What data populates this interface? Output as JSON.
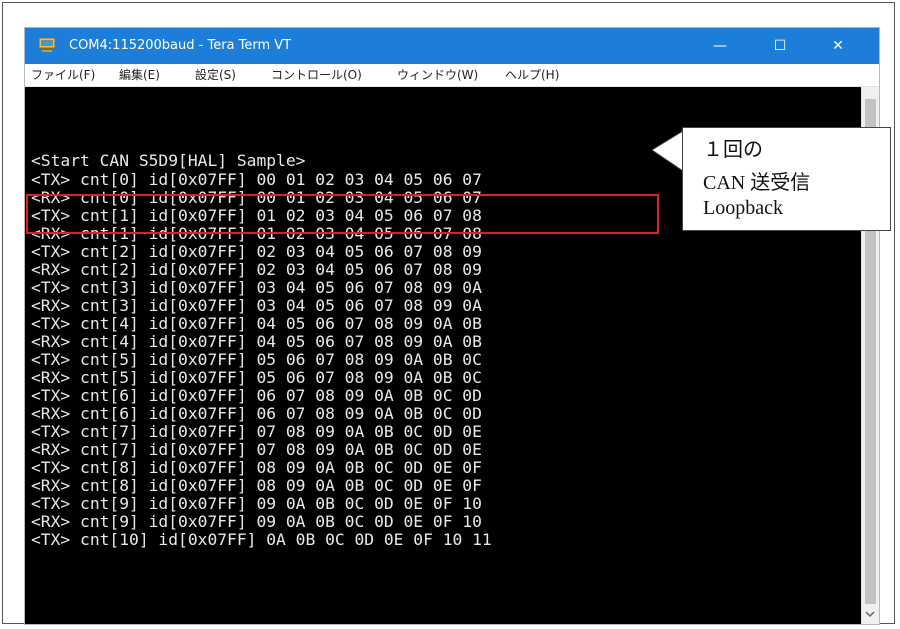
{
  "window": {
    "title": "COM4:115200baud - Tera Term VT",
    "controls": {
      "minimize": "—",
      "maximize": "☐",
      "close": "✕"
    }
  },
  "menu": [
    {
      "label": "ファイル(F)"
    },
    {
      "label": "編集(E)"
    },
    {
      "label": "設定(S)"
    },
    {
      "label": "コントロール(O)"
    },
    {
      "label": "ウィンドウ(W)"
    },
    {
      "label": "ヘルプ(H)"
    }
  ],
  "terminal": {
    "lines": [
      "<Start CAN S5D9[HAL] Sample>",
      "<TX> cnt[0] id[0x07FF] 00 01 02 03 04 05 06 07",
      "<RX> cnt[0] id[0x07FF] 00 01 02 03 04 05 06 07",
      "<TX> cnt[1] id[0x07FF] 01 02 03 04 05 06 07 08",
      "<RX> cnt[1] id[0x07FF] 01 02 03 04 05 06 07 08",
      "<TX> cnt[2] id[0x07FF] 02 03 04 05 06 07 08 09",
      "<RX> cnt[2] id[0x07FF] 02 03 04 05 06 07 08 09",
      "<TX> cnt[3] id[0x07FF] 03 04 05 06 07 08 09 0A",
      "<RX> cnt[3] id[0x07FF] 03 04 05 06 07 08 09 0A",
      "<TX> cnt[4] id[0x07FF] 04 05 06 07 08 09 0A 0B",
      "<RX> cnt[4] id[0x07FF] 04 05 06 07 08 09 0A 0B",
      "<TX> cnt[5] id[0x07FF] 05 06 07 08 09 0A 0B 0C",
      "<RX> cnt[5] id[0x07FF] 05 06 07 08 09 0A 0B 0C",
      "<TX> cnt[6] id[0x07FF] 06 07 08 09 0A 0B 0C 0D",
      "<RX> cnt[6] id[0x07FF] 06 07 08 09 0A 0B 0C 0D",
      "<TX> cnt[7] id[0x07FF] 07 08 09 0A 0B 0C 0D 0E",
      "<RX> cnt[7] id[0x07FF] 07 08 09 0A 0B 0C 0D 0E",
      "<TX> cnt[8] id[0x07FF] 08 09 0A 0B 0C 0D 0E 0F",
      "<RX> cnt[8] id[0x07FF] 08 09 0A 0B 0C 0D 0E 0F",
      "<TX> cnt[9] id[0x07FF] 09 0A 0B 0C 0D 0E 0F 10",
      "<RX> cnt[9] id[0x07FF] 09 0A 0B 0C 0D 0E 0F 10",
      "<TX> cnt[10] id[0x07FF] 0A 0B 0C 0D 0E 0F 10 11"
    ]
  },
  "callout": {
    "lines": [
      "１回の",
      "CAN 送受信",
      "Loopback"
    ]
  },
  "colors": {
    "titlebar": "#1d7ed9",
    "terminal_bg": "#000000",
    "terminal_text": "#e8e8e8",
    "highlight": "#e02020"
  },
  "icons": {
    "app": "tera-term-app-icon",
    "scroll_down": "chevron-down-icon"
  }
}
